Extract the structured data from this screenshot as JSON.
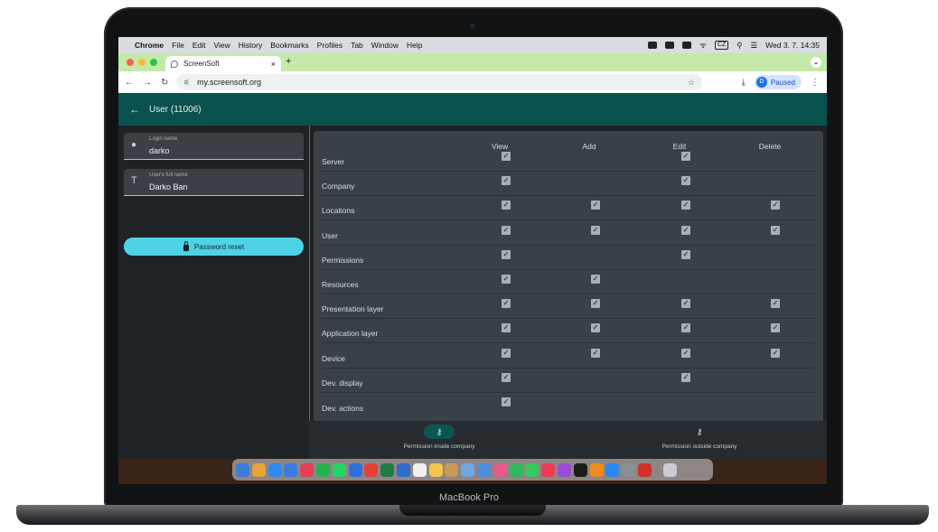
{
  "device": {
    "model": "MacBook Pro"
  },
  "menubar": {
    "apple": "",
    "items": [
      "Chrome",
      "File",
      "Edit",
      "View",
      "History",
      "Bookmarks",
      "Profiles",
      "Tab",
      "Window",
      "Help"
    ],
    "keyboard": "CZ",
    "datetime": "Wed 3. 7.  14:35"
  },
  "browser": {
    "tab_title": "ScreenSoft",
    "tab_close": "×",
    "new_tab": "+",
    "url": "my.screensoft.org",
    "profile_initial": "D",
    "profile_status": "Paused"
  },
  "app": {
    "title": "User (11006)",
    "login": {
      "label": "Login name",
      "value": "darko"
    },
    "fullname": {
      "label": "User's full name",
      "value": "Darko Ban"
    },
    "password_reset_label": "Password reset",
    "columns": [
      "View",
      "Add",
      "Edit",
      "Delete"
    ],
    "rows": [
      {
        "name": "Server",
        "view": true,
        "add": false,
        "edit": true,
        "delete": false
      },
      {
        "name": "Company",
        "view": true,
        "add": false,
        "edit": true,
        "delete": false
      },
      {
        "name": "Locations",
        "view": true,
        "add": true,
        "edit": true,
        "delete": true
      },
      {
        "name": "User",
        "view": true,
        "add": true,
        "edit": true,
        "delete": true
      },
      {
        "name": "Permissions",
        "view": true,
        "add": false,
        "edit": true,
        "delete": false
      },
      {
        "name": "Resources",
        "view": true,
        "add": true,
        "edit": false,
        "delete": false
      },
      {
        "name": "Presentation layer",
        "view": true,
        "add": true,
        "edit": true,
        "delete": true
      },
      {
        "name": "Application layer",
        "view": true,
        "add": true,
        "edit": true,
        "delete": true
      },
      {
        "name": "Device",
        "view": true,
        "add": true,
        "edit": true,
        "delete": true
      },
      {
        "name": "Dev. display",
        "view": true,
        "add": false,
        "edit": true,
        "delete": false
      },
      {
        "name": "Dev. actions",
        "view": true,
        "add": false,
        "edit": false,
        "delete": false
      }
    ],
    "bottom_nav": [
      {
        "label": "Permission inside company",
        "active": true,
        "icon": "key-icon"
      },
      {
        "label": "Permission outside company",
        "active": false,
        "icon": "key-icon"
      }
    ]
  },
  "dock": {
    "colors": [
      "#3d7bd9",
      "#e8a33a",
      "#2e8af0",
      "#3b7be0",
      "#e0405a",
      "#23b34a",
      "#25d366",
      "#2f6fdc",
      "#e2413a",
      "#1f7d43",
      "#2d6bcc",
      "#f1f1f1",
      "#f3c54a",
      "#c89a5a",
      "#6fa7e8",
      "#4f8de0",
      "#e55a8a",
      "#32b85e",
      "#38c95a",
      "#ee3a55",
      "#9b4bd6",
      "#1c1c1c",
      "#f08c1a",
      "#2a86f0",
      "#8a8f95",
      "#d3302a"
    ],
    "trash_color": "#c9ccd0"
  }
}
